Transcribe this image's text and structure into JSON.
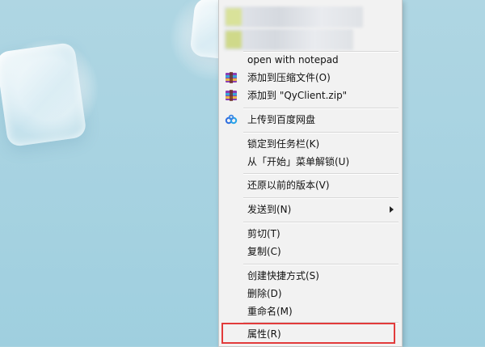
{
  "colors": {
    "highlight": "#e23b3b",
    "menu_bg": "#f2f2f2",
    "desktop": "#a9d3e0"
  },
  "menu": {
    "blurred_top_rows": 2,
    "items": [
      {
        "label": "open with notepad",
        "icon": null
      },
      {
        "label": "添加到压缩文件(O)",
        "icon": "winrar-archive-icon"
      },
      {
        "label": "添加到 \"QyClient.zip\"",
        "icon": "winrar-archive-icon"
      },
      {
        "label": "上传到百度网盘",
        "icon": "baidu-netdisk-icon"
      },
      {
        "label": "锁定到任务栏(K)",
        "icon": null
      },
      {
        "label": "从「开始」菜单解锁(U)",
        "icon": null
      },
      {
        "label": "还原以前的版本(V)",
        "icon": null
      },
      {
        "label": "发送到(N)",
        "icon": null,
        "submenu": true
      },
      {
        "label": "剪切(T)",
        "icon": null
      },
      {
        "label": "复制(C)",
        "icon": null
      },
      {
        "label": "创建快捷方式(S)",
        "icon": null
      },
      {
        "label": "删除(D)",
        "icon": null
      },
      {
        "label": "重命名(M)",
        "icon": null
      },
      {
        "label": "属性(R)",
        "icon": null,
        "highlighted": true
      }
    ]
  }
}
